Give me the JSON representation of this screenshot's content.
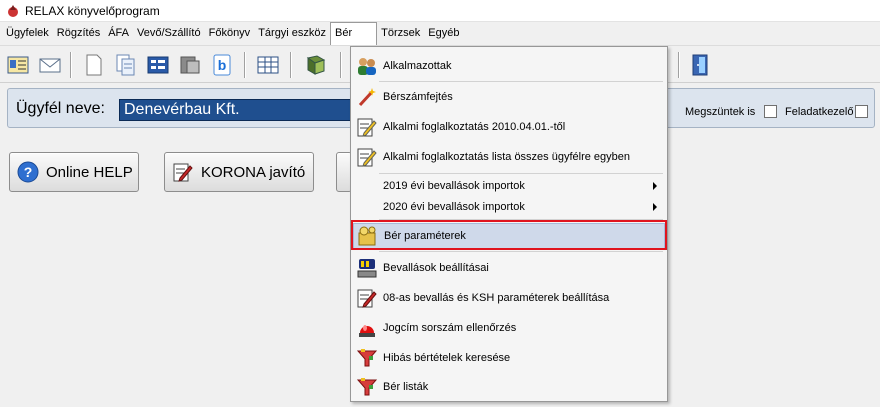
{
  "window": {
    "title": "RELAX könyvelőprogram"
  },
  "menu": {
    "items": [
      "Ügyfelek",
      "Rögzítés",
      "ÁFA",
      "Vevő/Szállító",
      "Főkönyv",
      "Tárgyi eszköz",
      "Bér",
      "Törzsek",
      "Egyéb"
    ],
    "open_item": "Bér"
  },
  "toolbar": {
    "icons": [
      "customer-card-icon",
      "mail-icon",
      "document-icon",
      "copy-document-icon",
      "calculator-icon",
      "gray-document-icon",
      "blue-b-icon",
      "table-grid-icon",
      "book-icon",
      "exit-door-icon"
    ]
  },
  "client": {
    "label": "Ügyfél neve:",
    "value": "Denevérbau Kft.",
    "option_closed": "Megszüntek is",
    "option_processor": "Feladatkezelő"
  },
  "buttons": {
    "help": "Online HELP",
    "korona": "KORONA javító"
  },
  "dropdown": {
    "items": [
      {
        "label": "Alkalmazottak",
        "icon": "employees-icon"
      },
      {
        "label": "Bérszámfejtés",
        "icon": "magic-wand-icon"
      },
      {
        "label": "Alkalmi foglalkoztatás 2010.04.01.-től",
        "icon": "edit-note-icon"
      },
      {
        "label": "Alkalmi foglalkoztatás lista összes ügyfélre egyben",
        "icon": "edit-note-icon"
      },
      {
        "label": "2019 évi bevallások importok",
        "icon": ""
      },
      {
        "label": "2020 évi bevallások importok",
        "icon": ""
      },
      {
        "label": "Bér paraméterek",
        "icon": "parameters-icon"
      },
      {
        "label": "Bevallások beállításai",
        "icon": "settings-machine-icon"
      },
      {
        "label": "08-as bevallás és KSH paraméterek beállítása",
        "icon": "edit-note-icon"
      },
      {
        "label": "Jogcím sorszám ellenőrzés",
        "icon": "red-alarm-icon"
      },
      {
        "label": "Hibás bértételek keresése",
        "icon": "filter-funnel-icon"
      },
      {
        "label": "Bér listák",
        "icon": "filter-funnel-icon"
      }
    ],
    "highlighted": "Bér paraméterek"
  },
  "colors": {
    "client_input_bg": "#1f4f8f",
    "highlight_frame": "#e0141e",
    "highlight_bg": "#cfd9ea"
  }
}
